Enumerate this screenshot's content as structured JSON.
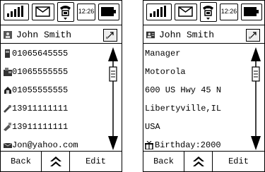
{
  "screens": [
    {
      "status": {
        "time": "12:26"
      },
      "contact_name": "John Smith",
      "rows": [
        {
          "icon": "desk-phone-icon",
          "text": "01065645555"
        },
        {
          "icon": "fax-icon",
          "text": "01065555555"
        },
        {
          "icon": "home-phone-icon",
          "text": "01055555555"
        },
        {
          "icon": "mobile-phone-icon",
          "text": "13911111111"
        },
        {
          "icon": "pager-icon",
          "text": "13911111111"
        },
        {
          "icon": "email-icon",
          "text": "Jon@yahoo.com"
        }
      ],
      "softkeys": {
        "left": "Back",
        "right": "Edit"
      }
    },
    {
      "status": {
        "time": "12:26"
      },
      "contact_name": "John Smith",
      "rows": [
        {
          "icon": "",
          "text": "Manager"
        },
        {
          "icon": "",
          "text": "Motorola"
        },
        {
          "icon": "",
          "text": "600 US Hwy 45 N"
        },
        {
          "icon": "",
          "text": "Libertyville,IL"
        },
        {
          "icon": "",
          "text": "USA"
        },
        {
          "icon": "gift-icon",
          "text": "Birthday:2000"
        }
      ],
      "softkeys": {
        "left": "Back",
        "right": "Edit"
      }
    }
  ]
}
